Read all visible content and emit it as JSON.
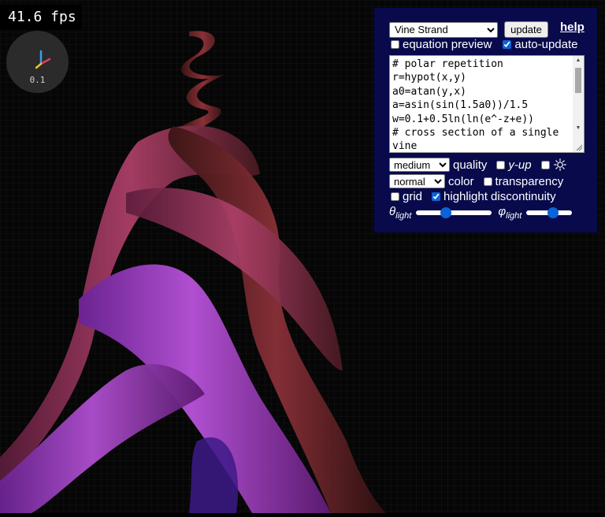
{
  "fps": {
    "label": "41.6 fps"
  },
  "axes_widget": {
    "scale": "0.1",
    "colors": {
      "x": "#e0405a",
      "y": "#3b9ee8",
      "z": "#e8c23b"
    }
  },
  "render": {
    "colors": {
      "violet": "#8b2fb0",
      "rose": "#a8385e",
      "red_brown": "#7a2a2a",
      "background": "#060606"
    }
  },
  "panel": {
    "background": "#080a4c",
    "preset": {
      "selected": "Vine Strand"
    },
    "update_label": "update",
    "help_label": "help",
    "equation_preview": {
      "label": "equation preview",
      "checked": false
    },
    "auto_update": {
      "label": "auto-update",
      "checked": true
    },
    "equation_lines": [
      "# polar repetition",
      "r=hypot(x,y)",
      "a0=atan(y,x)",
      "a=asin(sin(1.5a0))/1.5",
      "w=0.1+0.5ln(ln(e^-z+e))",
      "# cross section of a single",
      "vine"
    ],
    "quality": {
      "selected": "medium",
      "label": "quality"
    },
    "y_up": {
      "label": "y-up",
      "checked": false
    },
    "light_toggle": {
      "checked": false,
      "icon": "sun-icon"
    },
    "color": {
      "selected": "normal",
      "label": "color"
    },
    "transparency": {
      "label": "transparency",
      "checked": false
    },
    "grid": {
      "label": "grid",
      "checked": false
    },
    "highlight_discontinuity": {
      "label": "highlight discontinuity",
      "checked": true
    },
    "theta_light": {
      "symbol": "θ",
      "subscript": "light",
      "value": 0.38
    },
    "phi_light": {
      "symbol": "φ",
      "subscript": "light",
      "value": 0.6
    }
  }
}
